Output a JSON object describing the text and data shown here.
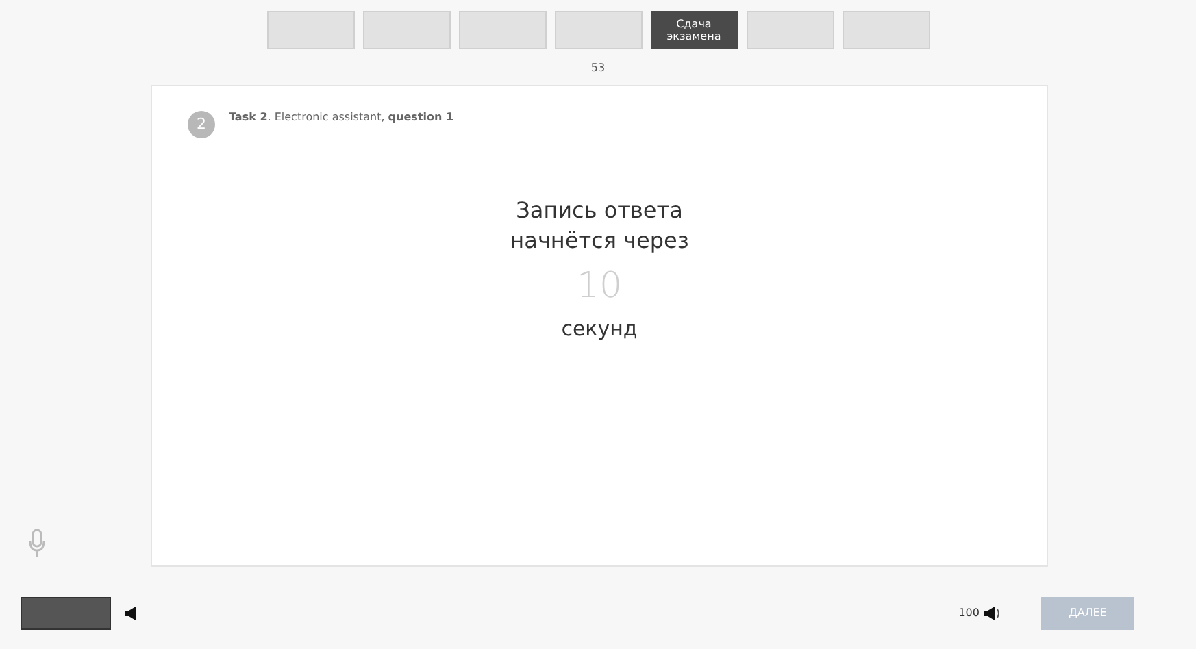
{
  "tabs": [
    {
      "selected": false
    },
    {
      "selected": false
    },
    {
      "selected": false
    },
    {
      "selected": false
    },
    {
      "label": "Сдача экзамена",
      "selected": true
    },
    {
      "selected": false
    },
    {
      "selected": false
    }
  ],
  "page_number": "53",
  "task": {
    "number": "2",
    "title": "**Task 2**. Electronic assistant, **question 1**"
  },
  "countdown": {
    "line_1": "Запись ответа",
    "line_2": "начнётся через",
    "value": "10",
    "unit": "секунд"
  },
  "footer": {
    "volume": "100",
    "next_button": "ДАЛЕЕ"
  }
}
